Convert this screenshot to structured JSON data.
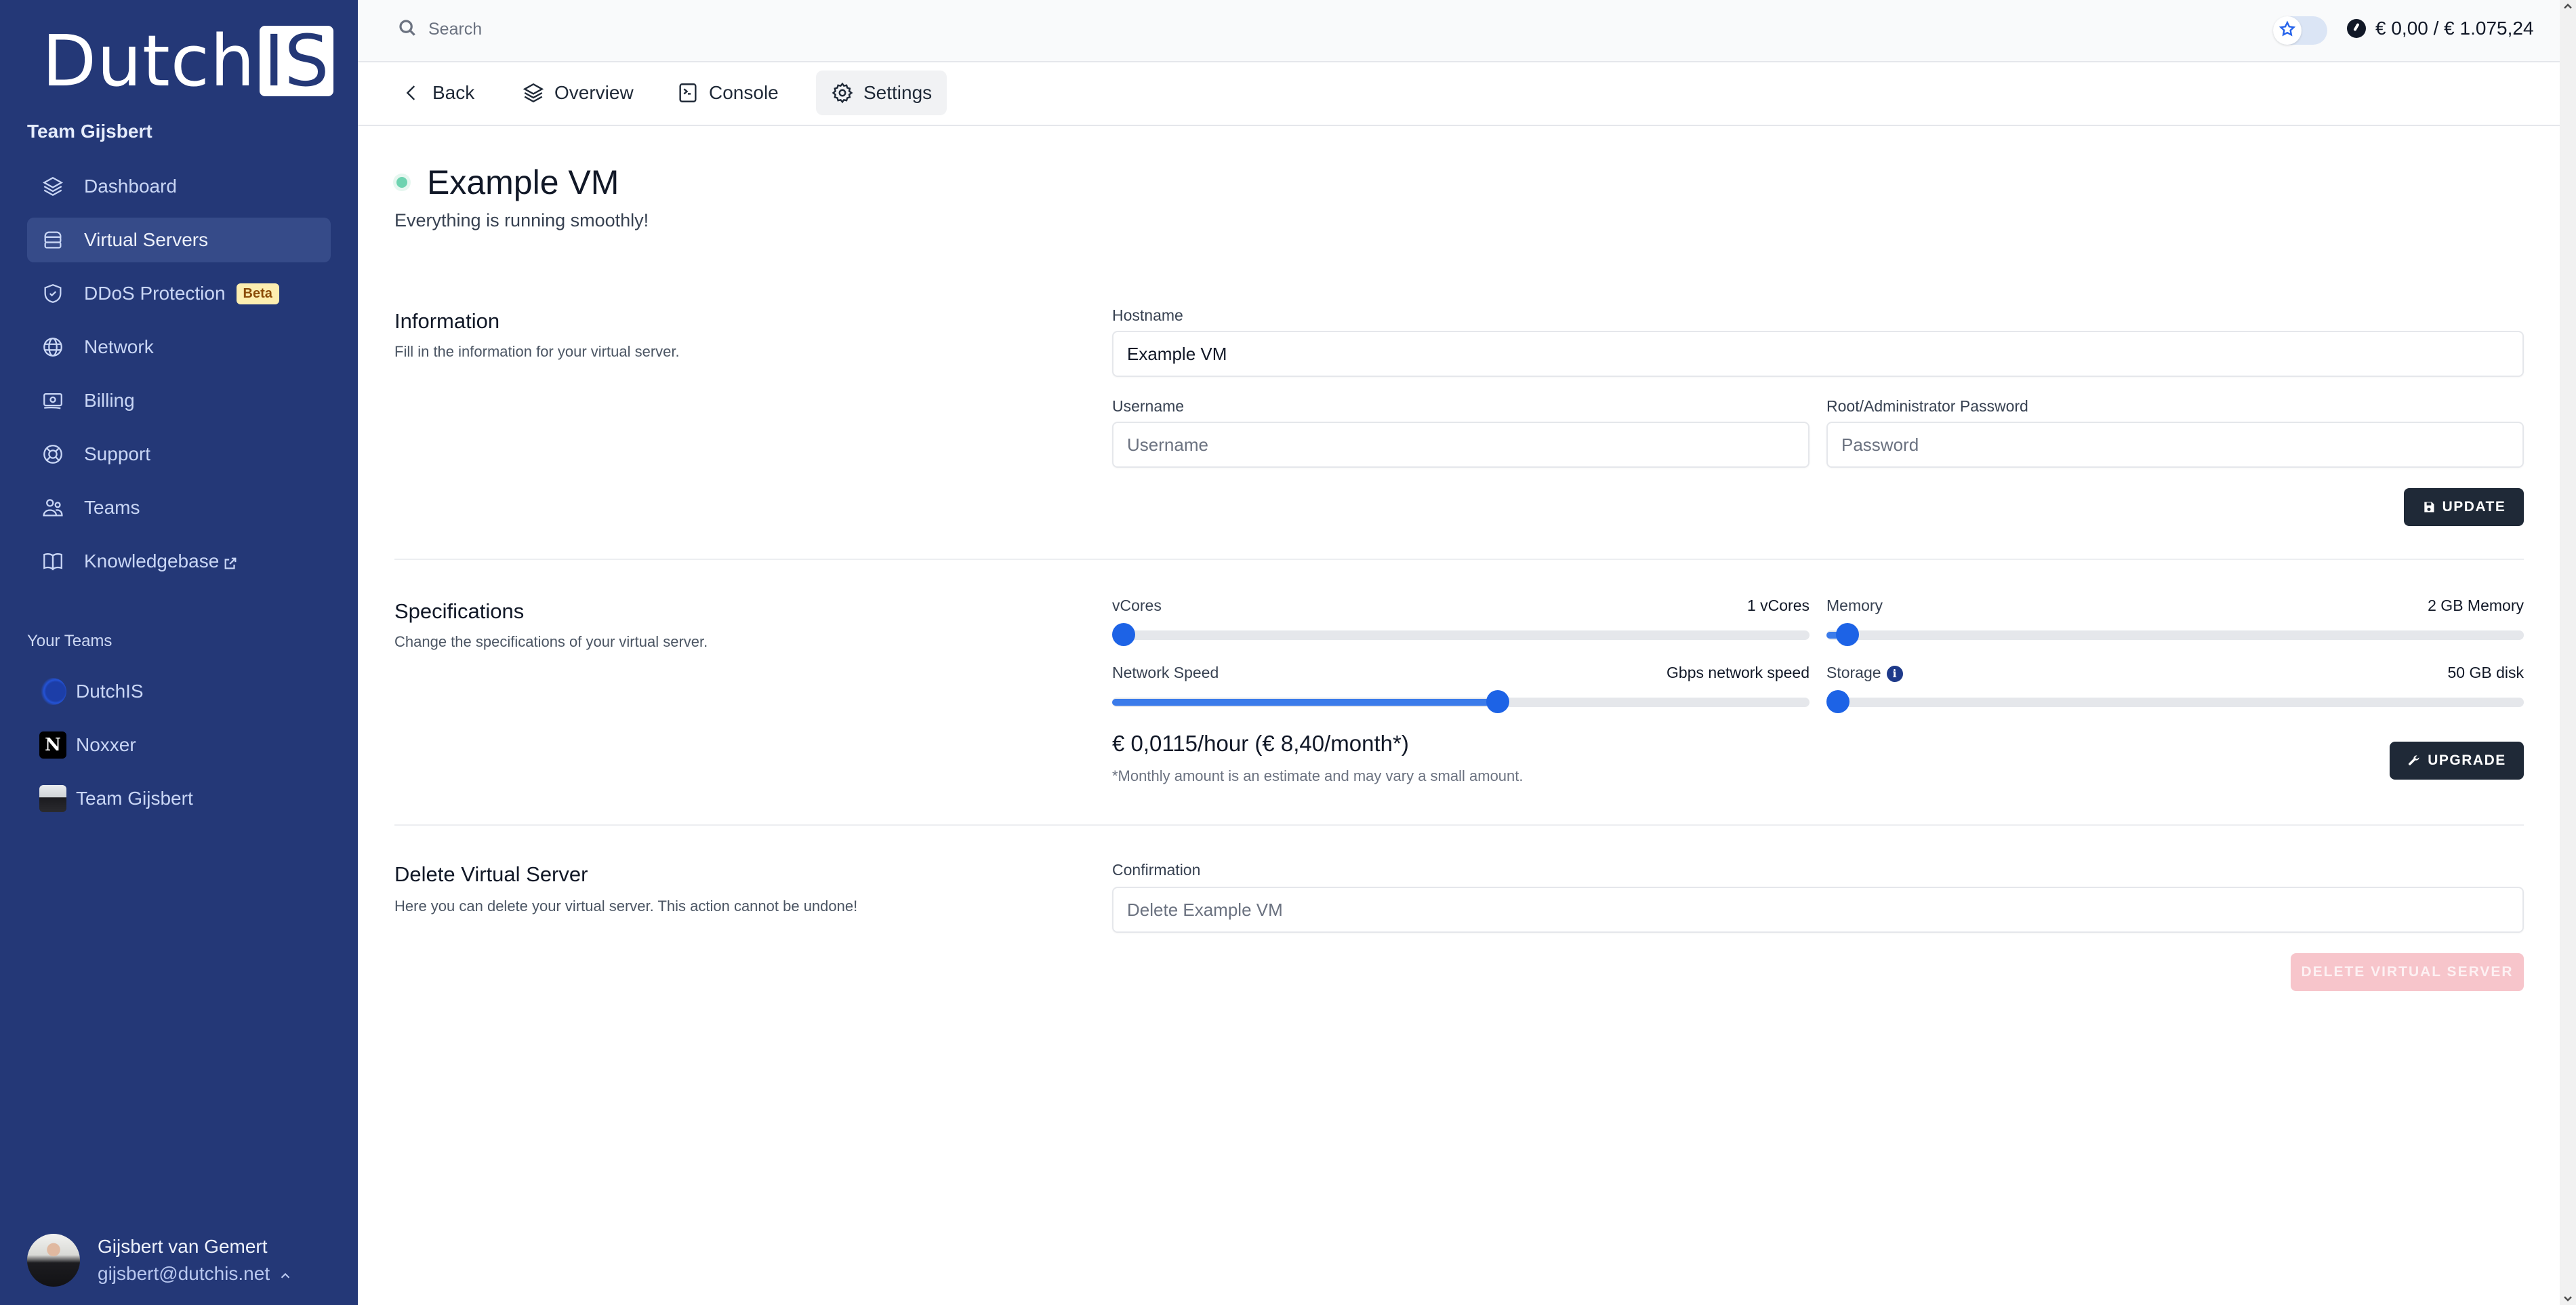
{
  "brand": {
    "word": "Dutch",
    "boxed": "IS"
  },
  "sidebar": {
    "team_name": "Team Gijsbert",
    "items": [
      {
        "label": "Dashboard",
        "icon": "layers-icon"
      },
      {
        "label": "Virtual Servers",
        "icon": "server-icon",
        "active": true
      },
      {
        "label": "DDoS Protection",
        "icon": "shield-check-icon",
        "badge": "Beta"
      },
      {
        "label": "Network",
        "icon": "globe-icon"
      },
      {
        "label": "Billing",
        "icon": "banknote-icon"
      },
      {
        "label": "Support",
        "icon": "lifebuoy-icon"
      },
      {
        "label": "Teams",
        "icon": "users-icon"
      },
      {
        "label": "Knowledgebase",
        "icon": "book-icon",
        "external": true
      }
    ],
    "your_teams_label": "Your Teams",
    "teams": [
      {
        "label": "DutchIS"
      },
      {
        "label": "Noxxer",
        "avatar_letter": "N"
      },
      {
        "label": "Team Gijsbert"
      }
    ],
    "user": {
      "name": "Gijsbert van Gemert",
      "email": "gijsbert@dutchis.net"
    }
  },
  "topbar": {
    "search_placeholder": "Search",
    "credit": "€ 0,00 / € 1.075,24"
  },
  "tabs": [
    {
      "label": "Back",
      "icon": "chevron-left-icon"
    },
    {
      "label": "Overview",
      "icon": "layers-icon"
    },
    {
      "label": "Console",
      "icon": "terminal-icon"
    },
    {
      "label": "Settings",
      "icon": "gear-icon",
      "active": true
    }
  ],
  "vm": {
    "name": "Example VM",
    "status_text": "Everything is running smoothly!",
    "status_color": "#6ed3b0"
  },
  "information": {
    "title": "Information",
    "description": "Fill in the information for your virtual server.",
    "hostname_label": "Hostname",
    "hostname_value": "Example VM",
    "username_label": "Username",
    "username_placeholder": "Username",
    "password_label": "Root/Administrator Password",
    "password_placeholder": "Password",
    "update_label": "UPDATE"
  },
  "specifications": {
    "title": "Specifications",
    "description": "Change the specifications of your virtual server.",
    "sliders": [
      {
        "label": "vCores",
        "value_text": "1 vCores",
        "fraction": 0.0
      },
      {
        "label": "Memory",
        "value_text": "2 GB Memory",
        "fraction": 0.03
      },
      {
        "label": "Network Speed",
        "value_text": "Gbps network speed",
        "fraction": 0.553
      },
      {
        "label": "Storage",
        "value_text": "50 GB disk",
        "fraction": 0.0,
        "info": true
      }
    ],
    "price": "€ 0,0115/hour (€ 8,40/month*)",
    "price_note": "*Monthly amount is an estimate and may vary a small amount.",
    "upgrade_label": "UPGRADE"
  },
  "delete": {
    "title": "Delete Virtual Server",
    "description": "Here you can delete your virtual server. This action cannot be undone!",
    "confirmation_label": "Confirmation",
    "confirmation_placeholder": "Delete Example VM",
    "button_label": "DELETE VIRTUAL SERVER"
  },
  "colors": {
    "sidebar_bg": "#243877",
    "accent": "#1d63e6",
    "dark_button": "#1f2937",
    "danger_disabled": "#f7c5cb",
    "beta_badge": "#fdeeb0"
  }
}
